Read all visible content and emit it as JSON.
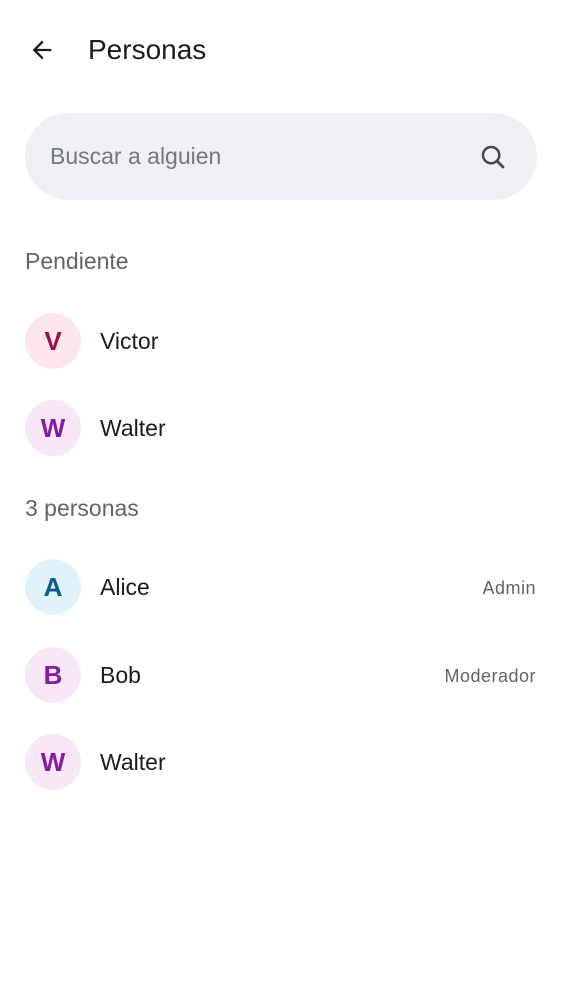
{
  "header": {
    "title": "Personas",
    "back_icon": "arrow-left-icon"
  },
  "search": {
    "placeholder": "Buscar a alguien",
    "value": "",
    "icon": "search-icon"
  },
  "pending": {
    "header": "Pendiente",
    "people": [
      {
        "initial": "V",
        "name": "Victor",
        "avatar_bg": "#fde7ec",
        "avatar_fg": "#9b0f4d"
      },
      {
        "initial": "W",
        "name": "Walter",
        "avatar_bg": "#f8e8f7",
        "avatar_fg": "#8719a0"
      }
    ]
  },
  "members": {
    "header": "3 personas",
    "people": [
      {
        "initial": "A",
        "name": "Alice",
        "role": "Admin",
        "avatar_bg": "#e1f3fa",
        "avatar_fg": "#0a5d8c"
      },
      {
        "initial": "B",
        "name": "Bob",
        "role": "Moderador",
        "avatar_bg": "#f8e8f7",
        "avatar_fg": "#8719a0"
      },
      {
        "initial": "W",
        "name": "Walter",
        "role": "",
        "avatar_bg": "#f8e8f7",
        "avatar_fg": "#8719a0"
      }
    ]
  }
}
